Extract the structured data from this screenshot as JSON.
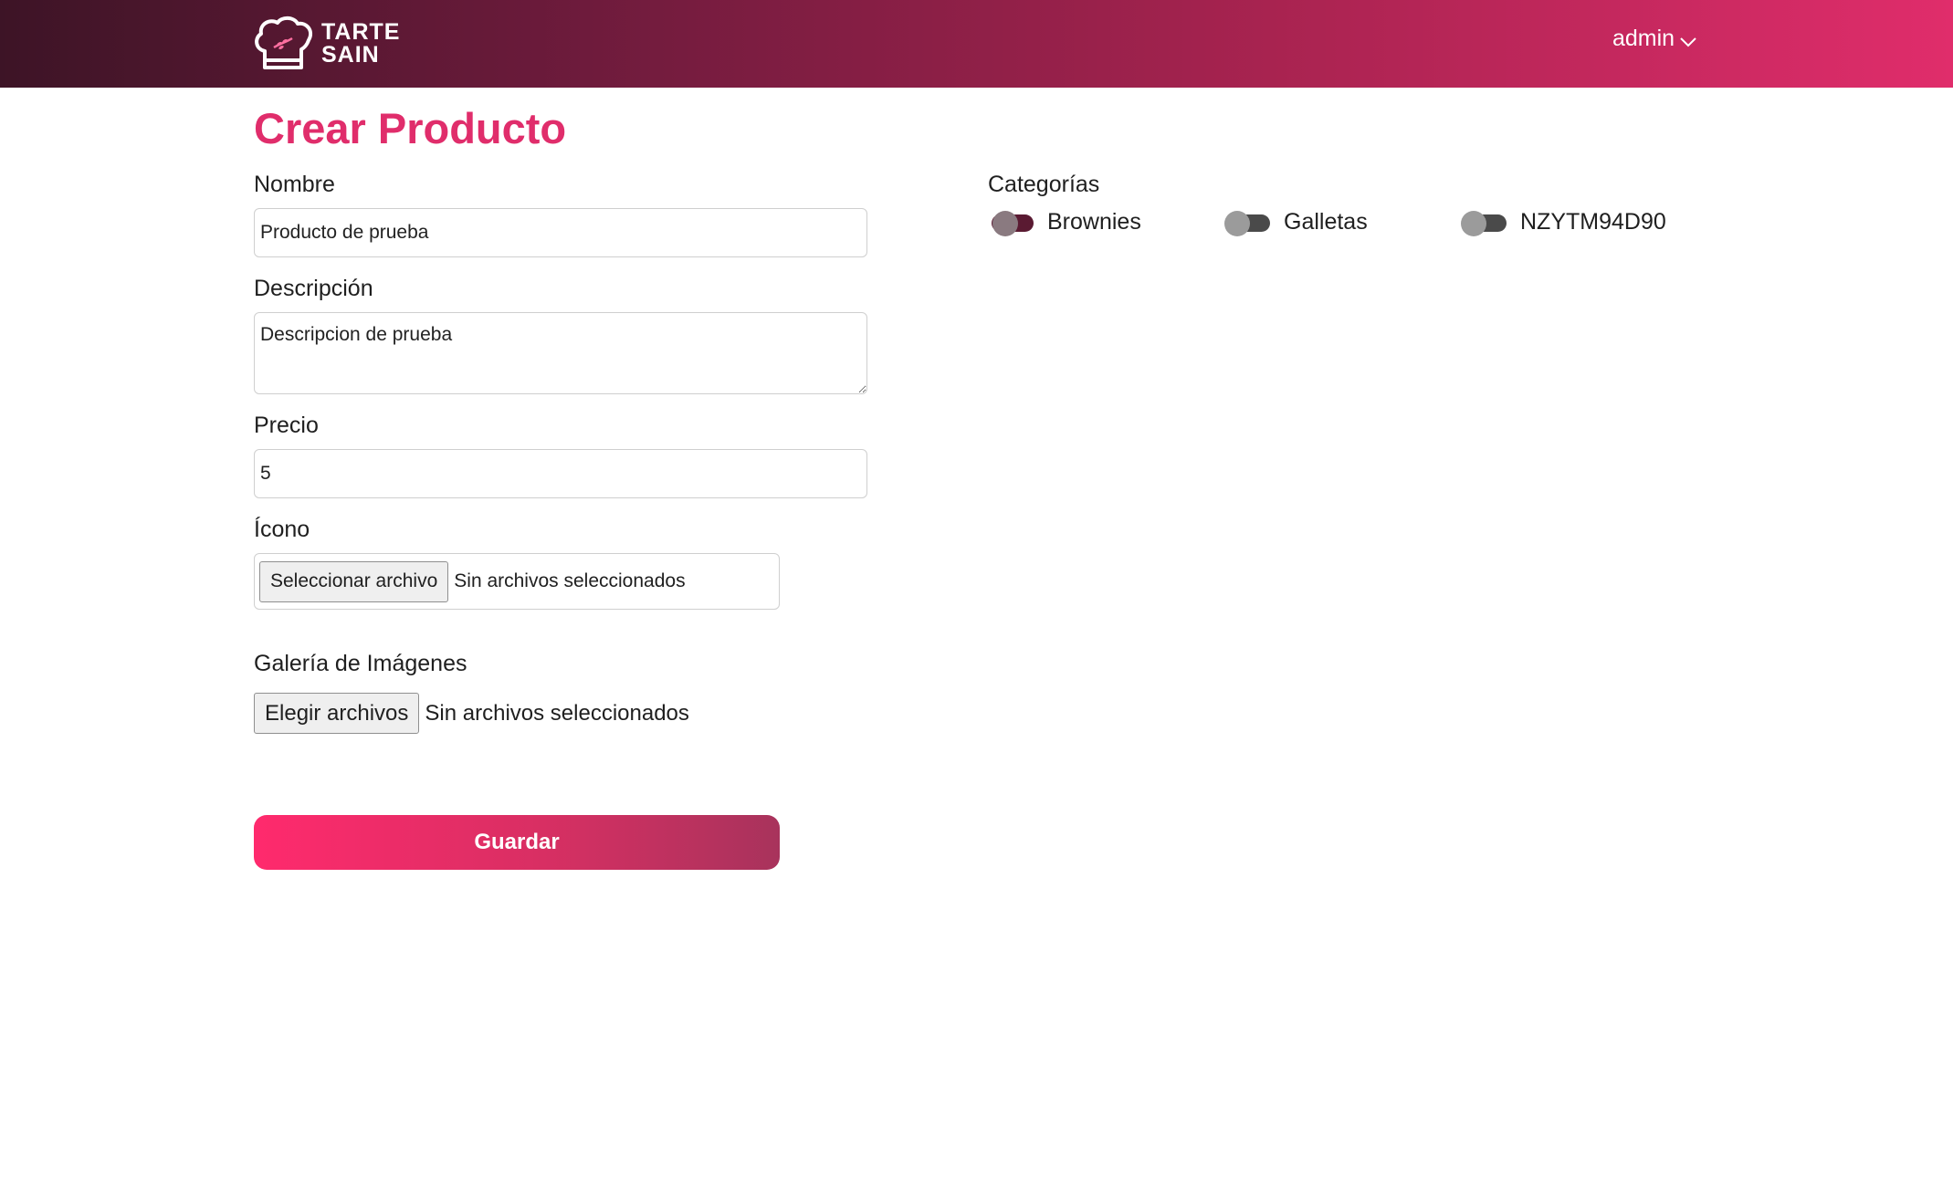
{
  "header": {
    "logo_text_line1": "TARTE",
    "logo_text_line2": "SAIN",
    "user_name": "admin"
  },
  "page": {
    "title": "Crear Producto"
  },
  "form": {
    "nombre": {
      "label": "Nombre",
      "value": "Producto de prueba"
    },
    "descripcion": {
      "label": "Descripción",
      "value": "Descripcion de prueba"
    },
    "precio": {
      "label": "Precio",
      "value": "5"
    },
    "icono": {
      "label": "Ícono",
      "button_label": "Seleccionar archivo",
      "status": "Sin archivos seleccionados"
    },
    "galeria": {
      "label": "Galería de Imágenes",
      "button_label": "Elegir archivos",
      "status": "Sin archivos seleccionados"
    },
    "save_label": "Guardar"
  },
  "categories": {
    "title": "Categorías",
    "items": [
      {
        "label": "Brownies",
        "checked": true
      },
      {
        "label": "Galletas",
        "checked": false
      },
      {
        "label": "NZYTM94D90",
        "checked": false
      }
    ]
  },
  "colors": {
    "accent": "#e02d6b",
    "header_dark": "#3d1426",
    "toggle_on": "#5a1a32"
  }
}
